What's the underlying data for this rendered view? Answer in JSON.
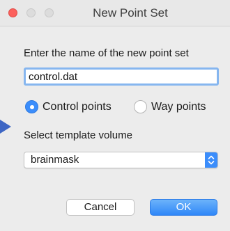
{
  "window": {
    "title": "New Point Set",
    "accent_color": "#3b8dfb"
  },
  "form": {
    "name_prompt": "Enter the name of the new point set",
    "name_value": "control.dat",
    "point_type": {
      "selected": "control",
      "options": [
        {
          "id": "control",
          "label": "Control points"
        },
        {
          "id": "way",
          "label": "Way points"
        }
      ]
    },
    "template_label": "Select template volume",
    "template_value": "brainmask"
  },
  "buttons": {
    "cancel_label": "Cancel",
    "ok_label": "OK"
  },
  "icons": {
    "close": "close-traffic-light",
    "minimize": "minimize-traffic-light",
    "maximize": "maximize-traffic-light",
    "select": "updown-chevron-icon",
    "pointer": "arrow-marker-icon"
  }
}
